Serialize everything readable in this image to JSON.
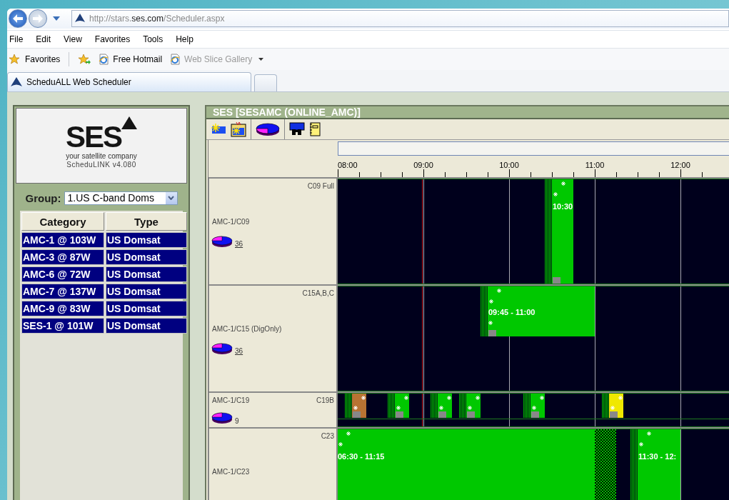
{
  "browser": {
    "url": "http://stars.**ses.com**/Scheduler.aspx",
    "menu": [
      "File",
      "Edit",
      "View",
      "Favorites",
      "Tools",
      "Help"
    ],
    "favorites_label": "Favorites",
    "links": [
      {
        "label": "Free Hotmail",
        "disabled": false
      },
      {
        "label": "Web Slice Gallery",
        "disabled": true
      }
    ],
    "tabs": [
      {
        "label": "ScheduALL Web Scheduler",
        "selected": true
      }
    ]
  },
  "sidebar": {
    "logo": {
      "wordmark": "SES",
      "tagline": "your satellite company",
      "version": "ScheduLINK v4.080"
    },
    "group_label": "Group:",
    "group_value": "1.US C-band Doms",
    "columns": [
      "Category",
      "Type"
    ],
    "rows": [
      [
        "AMC-1 @ 103W",
        "US Domsat"
      ],
      [
        "AMC-3 @ 87W",
        "US Domsat"
      ],
      [
        "AMC-6 @ 72W",
        "US Domsat"
      ],
      [
        "AMC-7 @ 137W",
        "US Domsat"
      ],
      [
        "AMC-9 @ 83W",
        "US Domsat"
      ],
      [
        "SES-1 @ 101W",
        "US Domsat"
      ]
    ]
  },
  "scheduler": {
    "title": "SES [SESAMC (ONLINE_AMC)]",
    "time_axis": {
      "ticks": [
        "08:00",
        "09:00",
        "10:00",
        "11:00",
        "12:00"
      ]
    },
    "rows": [
      {
        "kind": "full",
        "name": "AMC-1/C09",
        "transponder": "C09 Full",
        "count": "36",
        "linked": true,
        "events": [
          {
            "kind": "tall",
            "color": "#00c800",
            "label": "10:30"
          }
        ]
      },
      {
        "kind": "full",
        "name": "AMC-1/C15 (DigOnly)",
        "transponder": "C15A,B,C",
        "count": "36",
        "linked": true,
        "events": [
          {
            "kind": "half",
            "color": "#00c800",
            "label": "09:45 - 11:00"
          }
        ]
      },
      {
        "kind": "compact",
        "name": "AMC-1/C19",
        "transponder": "C19B",
        "count": "9",
        "linked": false,
        "events": [
          {
            "kind": "short",
            "color": "#b87333"
          },
          {
            "kind": "short",
            "color": "#00c800"
          },
          {
            "kind": "short",
            "color": "#00c800"
          },
          {
            "kind": "short",
            "color": "#00c800"
          },
          {
            "kind": "short",
            "color": "#00c800"
          },
          {
            "kind": "short",
            "color": "#f0e800"
          }
        ]
      },
      {
        "kind": "partial",
        "name": "AMC-1/C23",
        "transponder": "C23",
        "events": [
          {
            "kind": "tall",
            "color": "#00c800",
            "label": "06:30 - 11:15"
          },
          {
            "kind": "padding",
            "color": "#00c800"
          },
          {
            "kind": "tall",
            "color": "#00c800",
            "label": "11:30 - 12:"
          }
        ]
      }
    ]
  }
}
